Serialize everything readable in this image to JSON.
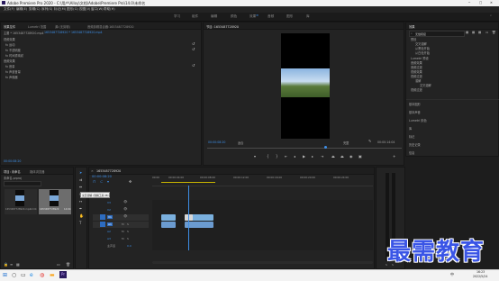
{
  "app": {
    "title": "Adobe Premiere Pro 2020 - C:\\用户\\Alloy\\文档\\Adobe\\Premiere Pro\\14.0\\未命名",
    "window_controls": {
      "minimize": "─",
      "maximize": "□",
      "close": "✕"
    }
  },
  "menu": [
    "文件(F)",
    "编辑(E)",
    "剪辑(C)",
    "序列(S)",
    "标记(M)",
    "图形(G)",
    "视图(V)",
    "窗口(W)",
    "帮助(H)"
  ],
  "workspaces": [
    "学习",
    "组件",
    "编辑",
    "颜色",
    "效果",
    "音频",
    "图形",
    "库"
  ],
  "workspace_active": "效果",
  "effect_controls": {
    "tabs": [
      "效果控件",
      "Lumetri 范围",
      "源:(无剪辑)",
      "音频剪辑混合器:1653487728920"
    ],
    "header": "主要 * 1653487728920.mp4",
    "sequence": "1653487728920 * 1653487728920.mp4",
    "section_video": "视频效果",
    "rows": [
      "fx  运动",
      "fx  不透明度",
      "fx  时间重映射",
      "音频效果",
      "fx  音量",
      "fx  声道音量",
      "fx  声像器"
    ],
    "timecode": "00:00:08:20"
  },
  "program": {
    "tab": "节目: 1653487728920",
    "timecode": "00:00:08:20",
    "fit": "适合",
    "quality": "完整",
    "duration": "00:00:14:04"
  },
  "effects": {
    "tab": "效果",
    "search_placeholder": "",
    "search_value": "无缝衔接",
    "tree": [
      "预设",
      "交叉溶解",
      "从黑色开始",
      "从白色开始",
      "Lumetri 预设",
      "音频效果",
      "音频过渡",
      "视频效果",
      "视频过渡",
      "溶解",
      "交叉溶解",
      "视频过渡"
    ],
    "sections": [
      "基本图形",
      "基本声音",
      "Lumetri 颜色",
      "库",
      "标记",
      "历史记录",
      "信息"
    ]
  },
  "project": {
    "tabs": [
      "项目: 未命名",
      "媒体浏览器"
    ],
    "file": "未命名.prproj",
    "items": [
      {
        "name": "1653487728920.mp4",
        "duration": "14:04"
      },
      {
        "name": "1653487728920",
        "duration": "14:04"
      }
    ]
  },
  "timeline": {
    "tab": "1653487728920",
    "timecode": "00:00:08:20",
    "ruler": [
      "00:00",
      "00:00:04:00",
      "00:00:08:00",
      "00:00:12:00",
      "00:00:16:00",
      "00:00:20:00",
      "00:00:24:00"
    ],
    "tooltip": "交叉溶解 (溶解工具 (B))",
    "tracks": [
      "V3",
      "V2",
      "V1",
      "A1",
      "A2",
      "A3"
    ],
    "master": "主声道",
    "master_value": "0.0"
  },
  "watermark": "最需教育",
  "taskbar": {
    "time": "16:23",
    "date": "2022/5/24",
    "lang": "中"
  },
  "colors": {
    "accent": "#3d8ee6",
    "clip_video": "#7ab0de",
    "clip_audio": "#6b9bd0",
    "playhead": "#3d8ee6"
  }
}
